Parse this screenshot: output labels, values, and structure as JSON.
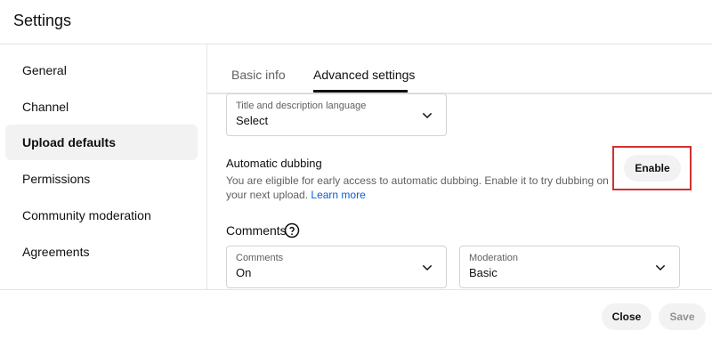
{
  "window": {
    "title": "Settings"
  },
  "sidebar": {
    "items": [
      {
        "label": "General",
        "active": false
      },
      {
        "label": "Channel",
        "active": false
      },
      {
        "label": "Upload defaults",
        "active": true
      },
      {
        "label": "Permissions",
        "active": false
      },
      {
        "label": "Community moderation",
        "active": false
      },
      {
        "label": "Agreements",
        "active": false
      }
    ]
  },
  "tabs": [
    {
      "label": "Basic info",
      "selected": false
    },
    {
      "label": "Advanced settings",
      "selected": true
    }
  ],
  "language_select": {
    "label": "Title and description language",
    "value": "Select",
    "icon": "chevron-down-icon"
  },
  "dubbing": {
    "title": "Automatic dubbing",
    "description": "You are eligible for early access to automatic dubbing. Enable it to try dubbing on your next upload.",
    "link": "Learn more",
    "button": "Enable",
    "highlight_color": "#d32f2f"
  },
  "comments": {
    "title": "Comments",
    "help_icon": "help-circle-icon",
    "comments_select": {
      "label": "Comments",
      "value": "On"
    },
    "moderation_select": {
      "label": "Moderation",
      "value": "Basic"
    }
  },
  "footer": {
    "close": "Close",
    "save": "Save",
    "save_enabled": false
  },
  "colors": {
    "link": "#065fd4",
    "muted_text": "#606060",
    "chip_bg": "#f2f2f2"
  }
}
